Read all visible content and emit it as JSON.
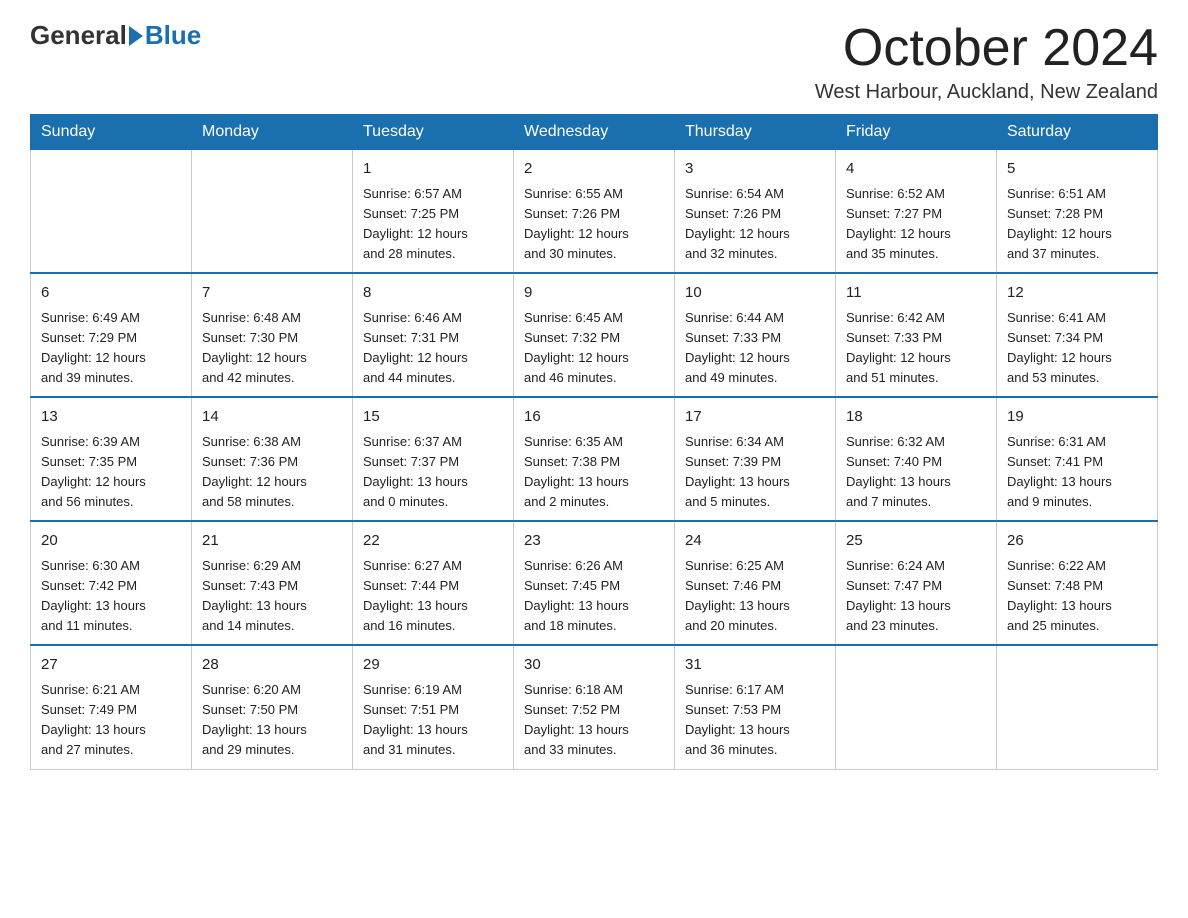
{
  "header": {
    "logo_general": "General",
    "logo_blue": "Blue",
    "month_title": "October 2024",
    "location": "West Harbour, Auckland, New Zealand"
  },
  "weekdays": [
    "Sunday",
    "Monday",
    "Tuesday",
    "Wednesday",
    "Thursday",
    "Friday",
    "Saturday"
  ],
  "weeks": [
    [
      {
        "day": "",
        "info": ""
      },
      {
        "day": "",
        "info": ""
      },
      {
        "day": "1",
        "info": "Sunrise: 6:57 AM\nSunset: 7:25 PM\nDaylight: 12 hours\nand 28 minutes."
      },
      {
        "day": "2",
        "info": "Sunrise: 6:55 AM\nSunset: 7:26 PM\nDaylight: 12 hours\nand 30 minutes."
      },
      {
        "day": "3",
        "info": "Sunrise: 6:54 AM\nSunset: 7:26 PM\nDaylight: 12 hours\nand 32 minutes."
      },
      {
        "day": "4",
        "info": "Sunrise: 6:52 AM\nSunset: 7:27 PM\nDaylight: 12 hours\nand 35 minutes."
      },
      {
        "day": "5",
        "info": "Sunrise: 6:51 AM\nSunset: 7:28 PM\nDaylight: 12 hours\nand 37 minutes."
      }
    ],
    [
      {
        "day": "6",
        "info": "Sunrise: 6:49 AM\nSunset: 7:29 PM\nDaylight: 12 hours\nand 39 minutes."
      },
      {
        "day": "7",
        "info": "Sunrise: 6:48 AM\nSunset: 7:30 PM\nDaylight: 12 hours\nand 42 minutes."
      },
      {
        "day": "8",
        "info": "Sunrise: 6:46 AM\nSunset: 7:31 PM\nDaylight: 12 hours\nand 44 minutes."
      },
      {
        "day": "9",
        "info": "Sunrise: 6:45 AM\nSunset: 7:32 PM\nDaylight: 12 hours\nand 46 minutes."
      },
      {
        "day": "10",
        "info": "Sunrise: 6:44 AM\nSunset: 7:33 PM\nDaylight: 12 hours\nand 49 minutes."
      },
      {
        "day": "11",
        "info": "Sunrise: 6:42 AM\nSunset: 7:33 PM\nDaylight: 12 hours\nand 51 minutes."
      },
      {
        "day": "12",
        "info": "Sunrise: 6:41 AM\nSunset: 7:34 PM\nDaylight: 12 hours\nand 53 minutes."
      }
    ],
    [
      {
        "day": "13",
        "info": "Sunrise: 6:39 AM\nSunset: 7:35 PM\nDaylight: 12 hours\nand 56 minutes."
      },
      {
        "day": "14",
        "info": "Sunrise: 6:38 AM\nSunset: 7:36 PM\nDaylight: 12 hours\nand 58 minutes."
      },
      {
        "day": "15",
        "info": "Sunrise: 6:37 AM\nSunset: 7:37 PM\nDaylight: 13 hours\nand 0 minutes."
      },
      {
        "day": "16",
        "info": "Sunrise: 6:35 AM\nSunset: 7:38 PM\nDaylight: 13 hours\nand 2 minutes."
      },
      {
        "day": "17",
        "info": "Sunrise: 6:34 AM\nSunset: 7:39 PM\nDaylight: 13 hours\nand 5 minutes."
      },
      {
        "day": "18",
        "info": "Sunrise: 6:32 AM\nSunset: 7:40 PM\nDaylight: 13 hours\nand 7 minutes."
      },
      {
        "day": "19",
        "info": "Sunrise: 6:31 AM\nSunset: 7:41 PM\nDaylight: 13 hours\nand 9 minutes."
      }
    ],
    [
      {
        "day": "20",
        "info": "Sunrise: 6:30 AM\nSunset: 7:42 PM\nDaylight: 13 hours\nand 11 minutes."
      },
      {
        "day": "21",
        "info": "Sunrise: 6:29 AM\nSunset: 7:43 PM\nDaylight: 13 hours\nand 14 minutes."
      },
      {
        "day": "22",
        "info": "Sunrise: 6:27 AM\nSunset: 7:44 PM\nDaylight: 13 hours\nand 16 minutes."
      },
      {
        "day": "23",
        "info": "Sunrise: 6:26 AM\nSunset: 7:45 PM\nDaylight: 13 hours\nand 18 minutes."
      },
      {
        "day": "24",
        "info": "Sunrise: 6:25 AM\nSunset: 7:46 PM\nDaylight: 13 hours\nand 20 minutes."
      },
      {
        "day": "25",
        "info": "Sunrise: 6:24 AM\nSunset: 7:47 PM\nDaylight: 13 hours\nand 23 minutes."
      },
      {
        "day": "26",
        "info": "Sunrise: 6:22 AM\nSunset: 7:48 PM\nDaylight: 13 hours\nand 25 minutes."
      }
    ],
    [
      {
        "day": "27",
        "info": "Sunrise: 6:21 AM\nSunset: 7:49 PM\nDaylight: 13 hours\nand 27 minutes."
      },
      {
        "day": "28",
        "info": "Sunrise: 6:20 AM\nSunset: 7:50 PM\nDaylight: 13 hours\nand 29 minutes."
      },
      {
        "day": "29",
        "info": "Sunrise: 6:19 AM\nSunset: 7:51 PM\nDaylight: 13 hours\nand 31 minutes."
      },
      {
        "day": "30",
        "info": "Sunrise: 6:18 AM\nSunset: 7:52 PM\nDaylight: 13 hours\nand 33 minutes."
      },
      {
        "day": "31",
        "info": "Sunrise: 6:17 AM\nSunset: 7:53 PM\nDaylight: 13 hours\nand 36 minutes."
      },
      {
        "day": "",
        "info": ""
      },
      {
        "day": "",
        "info": ""
      }
    ]
  ]
}
